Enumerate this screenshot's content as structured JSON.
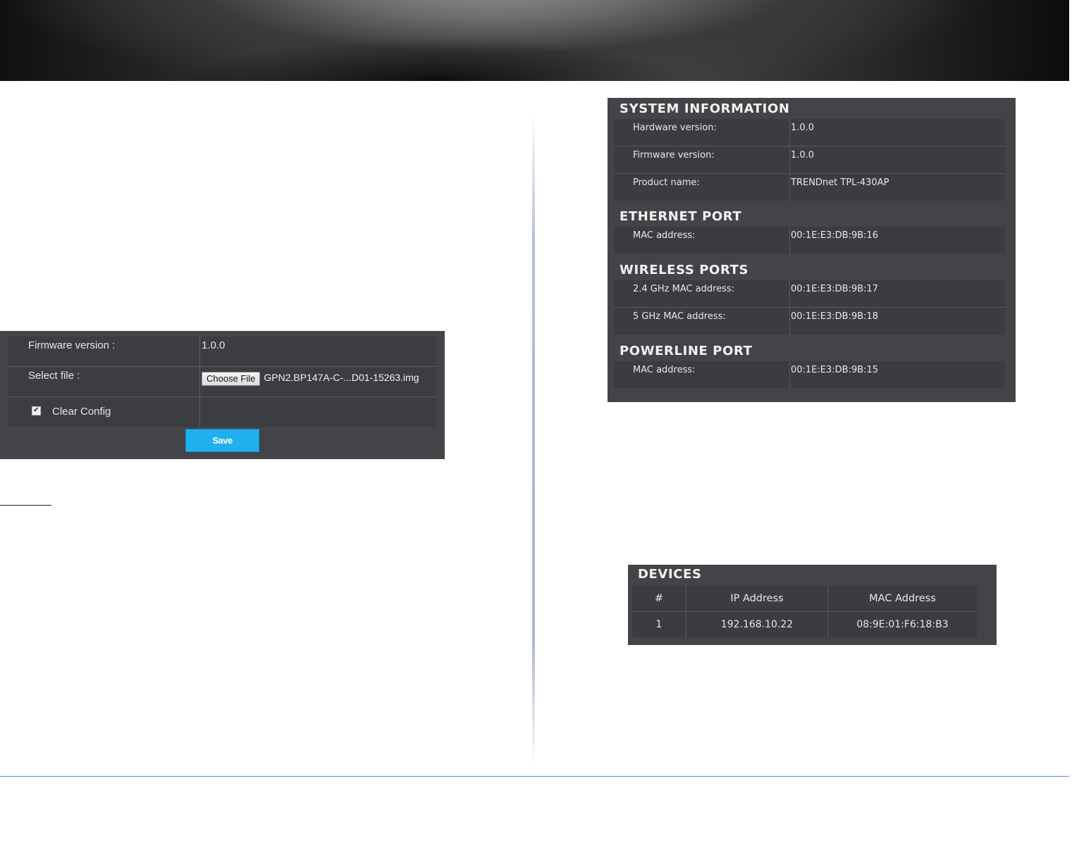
{
  "firmware_panel": {
    "firmware_version_label": "Firmware version :",
    "firmware_version_value": "1.0.0",
    "select_file_label": "Select file :",
    "choose_file_label": "Choose File",
    "selected_file_name": "GPN2.BP147A-C-...D01-15263.img",
    "clear_config_label": "Clear Config",
    "clear_config_checked": true,
    "save_label": "Save"
  },
  "system_panel": {
    "sections": [
      {
        "title": "SYSTEM INFORMATION",
        "rows": [
          {
            "label": "Hardware version:",
            "value": "1.0.0"
          },
          {
            "label": "Firmware version:",
            "value": "1.0.0"
          },
          {
            "label": "Product name:",
            "value": "TRENDnet TPL-430AP"
          }
        ]
      },
      {
        "title": "ETHERNET PORT",
        "rows": [
          {
            "label": "MAC address:",
            "value": "00:1E:E3:DB:9B:16"
          }
        ]
      },
      {
        "title": "WIRELESS PORTS",
        "rows": [
          {
            "label": "2.4 GHz MAC address:",
            "value": "00:1E:E3:DB:9B:17"
          },
          {
            "label": "5 GHz MAC address:",
            "value": "00:1E:E3:DB:9B:18"
          }
        ]
      },
      {
        "title": "POWERLINE PORT",
        "rows": [
          {
            "label": "MAC address:",
            "value": "00:1E:E3:DB:9B:15"
          }
        ]
      }
    ]
  },
  "devices_panel": {
    "title": "DEVICES",
    "columns": [
      "#",
      "IP Address",
      "MAC Address"
    ],
    "rows": [
      [
        "1",
        "192.168.10.22",
        "08:9E:01:F6:18:B3"
      ]
    ]
  },
  "colors": {
    "panel_bg": "#434447",
    "save_button": "#1fb0f0",
    "footer_rule": "#5b8bd0"
  }
}
